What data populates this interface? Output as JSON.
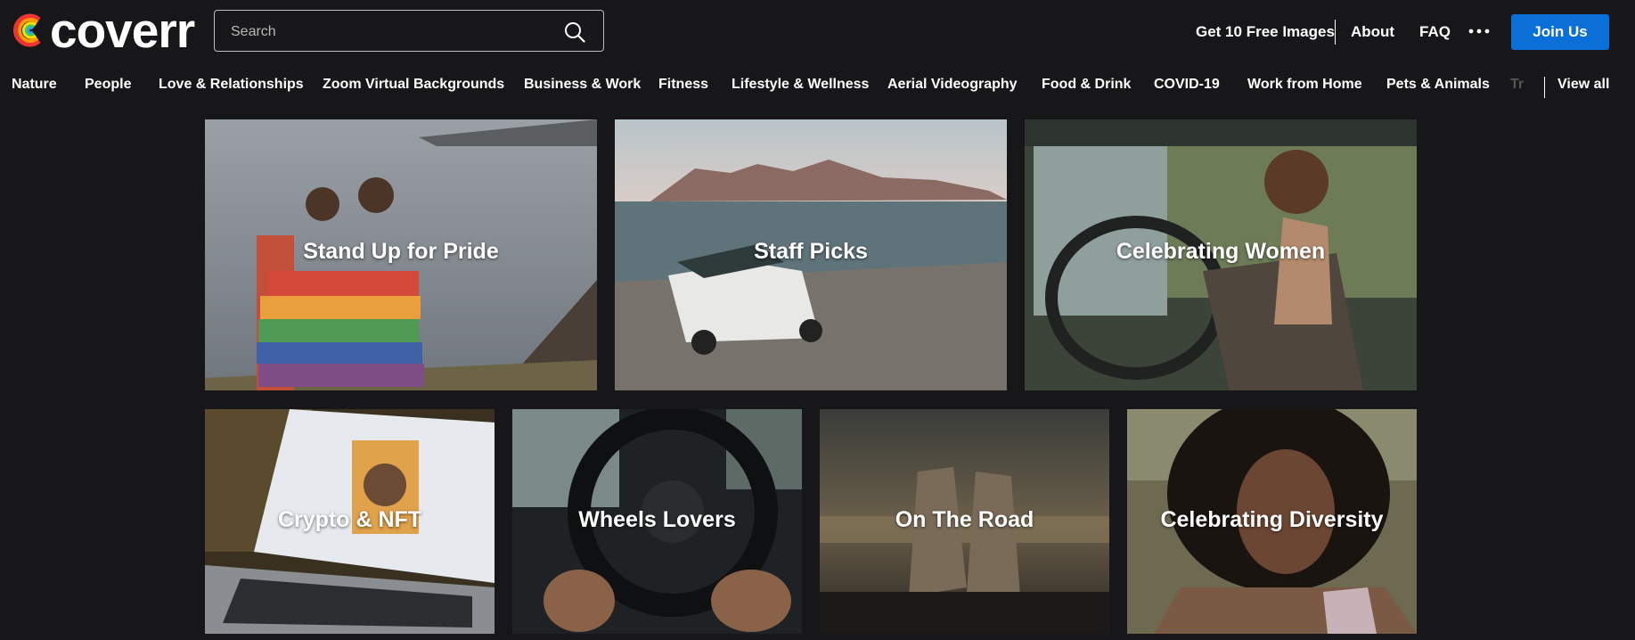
{
  "header": {
    "logo_text": "coverr",
    "search": {
      "placeholder": "Search",
      "value": ""
    },
    "nav": {
      "free_images": "Get 10 Free Images",
      "about": "About",
      "faq": "FAQ",
      "more": "…",
      "join": "Join Us"
    }
  },
  "categories": {
    "items": [
      "Nature",
      "People",
      "Love & Relationships",
      "Zoom Virtual Backgrounds",
      "Business & Work",
      "Fitness",
      "Lifestyle & Wellness",
      "Aerial Videography",
      "Food & Drink",
      "COVID-19",
      "Work from Home",
      "Pets & Animals"
    ],
    "truncated": "Tr",
    "view_all": "View all"
  },
  "collections": {
    "row1": [
      "Stand Up for Pride",
      "Staff Picks",
      "Celebrating Women"
    ],
    "row2": [
      "Crypto & NFT",
      "Wheels Lovers",
      "On The Road",
      "Celebrating Diversity"
    ]
  },
  "colors": {
    "accent": "#0a6fd6",
    "background": "#171719"
  }
}
